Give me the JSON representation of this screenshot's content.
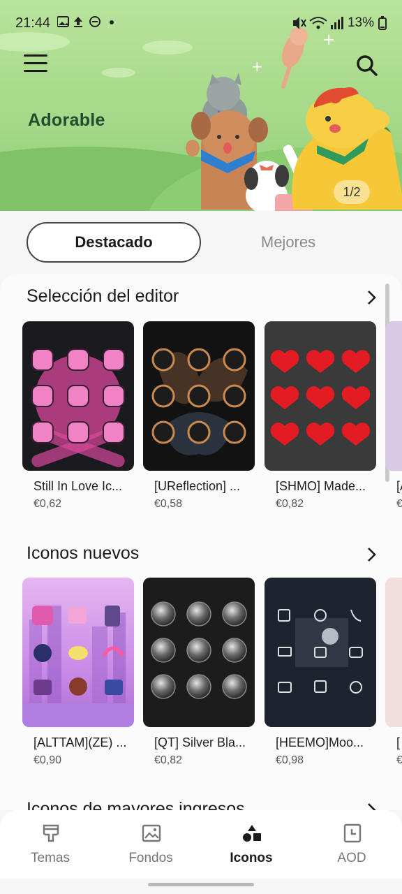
{
  "status_bar": {
    "time": "21:44",
    "battery": "13%",
    "left_icons": [
      "image-icon",
      "upload-icon",
      "dnd-icon",
      "dot-icon"
    ],
    "right_icons": [
      "mute-icon",
      "wifi-icon",
      "signal-icon",
      "battery-icon"
    ]
  },
  "banner": {
    "title": "Adorable",
    "counter": "1/2",
    "background_color": "#b9e39b"
  },
  "tabs": [
    {
      "label": "Destacado",
      "active": true
    },
    {
      "label": "Mejores",
      "active": false
    }
  ],
  "sections": [
    {
      "title": "Selección del editor",
      "items": [
        {
          "name": "Still In Love Ic...",
          "price": "€0,62"
        },
        {
          "name": "[UReflection] ...",
          "price": "€0,58"
        },
        {
          "name": "[SHMO] Made...",
          "price": "€0,82"
        },
        {
          "name": "[A",
          "price": "€"
        }
      ]
    },
    {
      "title": "Iconos nuevos",
      "items": [
        {
          "name": "[ALTTAM](ZE) ...",
          "price": "€0,90"
        },
        {
          "name": "[QT] Silver Bla...",
          "price": "€0,82"
        },
        {
          "name": "[HEEMO]Moo...",
          "price": "€0,98"
        },
        {
          "name": "[",
          "price": "€"
        }
      ]
    },
    {
      "title": "Iconos de mayores ingresos",
      "items": []
    }
  ],
  "bottom_nav": [
    {
      "label": "Temas",
      "icon": "brush-icon",
      "active": false
    },
    {
      "label": "Fondos",
      "icon": "image-icon",
      "active": false
    },
    {
      "label": "Iconos",
      "icon": "shapes-icon",
      "active": true
    },
    {
      "label": "AOD",
      "icon": "clock-icon",
      "active": false
    }
  ],
  "colors": {
    "accent_dark": "#1b1b1b",
    "banner_green": "#a4d887",
    "heart_red": "#e31b23",
    "pink_icon": "#e86fb4"
  }
}
